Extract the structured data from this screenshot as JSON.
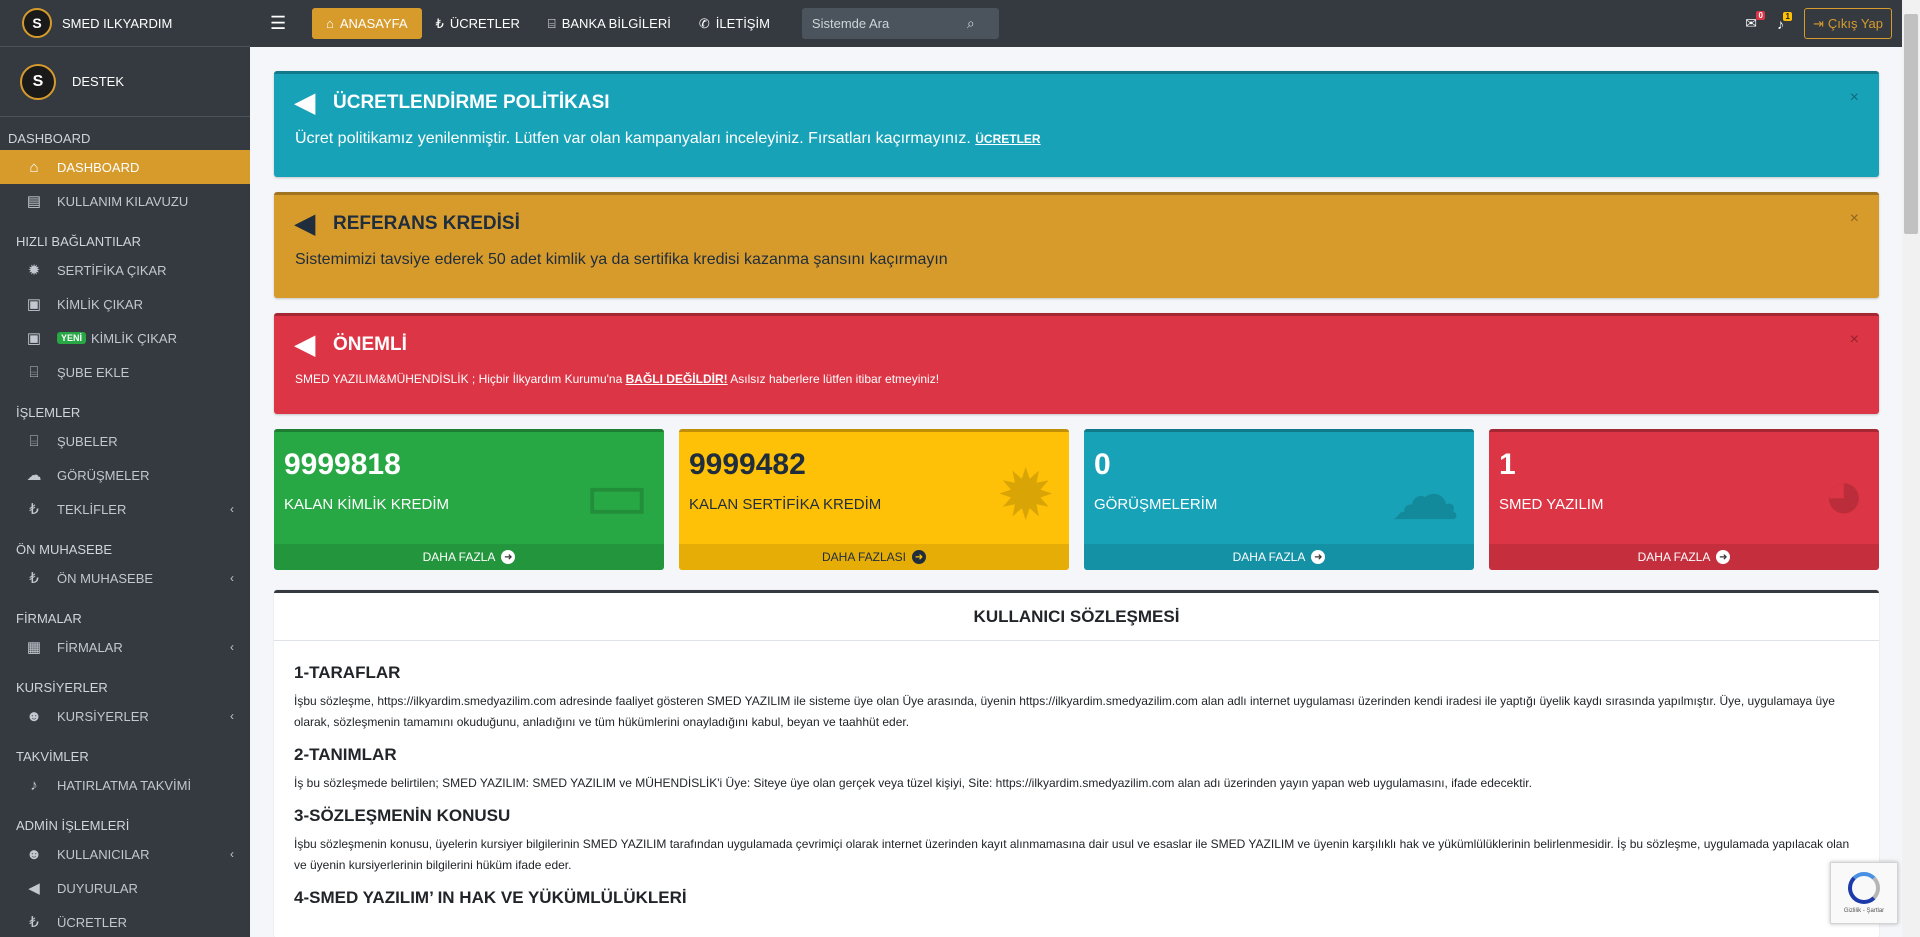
{
  "brand": {
    "logo": "S",
    "name": "SMED ILKYARDIM"
  },
  "user": {
    "logo": "S",
    "name": "DESTEK"
  },
  "sidebar": {
    "sections": [
      {
        "header": "DASHBOARD",
        "items": [
          {
            "label": "DASHBOARD",
            "icon": "home-icon",
            "glyph": "⌂",
            "active": true
          },
          {
            "label": "KULLANIM KILAVUZU",
            "icon": "book-icon",
            "glyph": "▤"
          }
        ]
      },
      {
        "header": "HIZLI BAĞLANTILAR",
        "items": [
          {
            "label": "SERTİFİKA ÇIKAR",
            "icon": "certificate-icon",
            "glyph": "✹"
          },
          {
            "label": "KİMLİK ÇIKAR",
            "icon": "id-card-icon",
            "glyph": "▣"
          },
          {
            "label": "KİMLİK ÇIKAR",
            "badge": "YENİ",
            "icon": "id-card-icon",
            "glyph": "▣"
          },
          {
            "label": "ŞUBE EKLE",
            "icon": "bank-icon",
            "glyph": "⌸"
          }
        ]
      },
      {
        "header": "İŞLEMLER",
        "items": [
          {
            "label": "ŞUBELER",
            "icon": "bank-icon",
            "glyph": "⌸"
          },
          {
            "label": "GÖRÜŞMELER",
            "icon": "comments-icon",
            "glyph": "☁"
          },
          {
            "label": "TEKLİFLER",
            "icon": "lira-icon",
            "glyph": "₺",
            "chevron": true
          }
        ]
      },
      {
        "header": "ÖN MUHASEBE",
        "items": [
          {
            "label": "ÖN MUHASEBE",
            "icon": "lira-icon",
            "glyph": "₺",
            "chevron": true
          }
        ]
      },
      {
        "header": "FİRMALAR",
        "items": [
          {
            "label": "FİRMALAR",
            "icon": "building-icon",
            "glyph": "▦",
            "chevron": true
          }
        ]
      },
      {
        "header": "KURSİYERLER",
        "items": [
          {
            "label": "KURSİYERLER",
            "icon": "users-icon",
            "glyph": "☻",
            "chevron": true
          }
        ]
      },
      {
        "header": "TAKVİMLER",
        "items": [
          {
            "label": "HATIRLATMA TAKVİMİ",
            "icon": "bell-icon",
            "glyph": "♪"
          }
        ]
      },
      {
        "header": "ADMİN İŞLEMLERİ",
        "items": [
          {
            "label": "KULLANICILAR",
            "icon": "users-icon",
            "glyph": "☻",
            "chevron": true
          },
          {
            "label": "DUYURULAR",
            "icon": "bullhorn-icon",
            "glyph": "◀"
          },
          {
            "label": "ÜCRETLER",
            "icon": "lira-icon",
            "glyph": "₺"
          }
        ]
      }
    ]
  },
  "topbar": {
    "menu_icon": "☰",
    "links": [
      {
        "label": "ANASAYFA",
        "icon": "home-icon",
        "glyph": "⌂",
        "active": true
      },
      {
        "label": "ÜCRETLER",
        "icon": "lira-icon",
        "glyph": "₺"
      },
      {
        "label": "BANKA BİLGİLERİ",
        "icon": "bank-icon",
        "glyph": "⌸"
      },
      {
        "label": "İLETİŞİM",
        "icon": "phone-icon",
        "glyph": "✆"
      }
    ],
    "search_placeholder": "Sistemde Ara",
    "messages_count": "0",
    "notifications_count": "1",
    "logout_label": "Çıkış Yap"
  },
  "alerts": {
    "pricing": {
      "title": "ÜCRETLENDİRME POLİTİKASI",
      "text": "Ücret politikamız yenilenmiştir. Lütfen var olan kampanyaları inceleyiniz. Fırsatları kaçırmayınız.",
      "link": "ÜCRETLER"
    },
    "referral": {
      "title": "REFERANS KREDİSİ",
      "text": "Sistemimizi tavsiye ederek 50 adet kimlik ya da sertifika kredisi kazanma şansını kaçırmayın"
    },
    "important": {
      "title": "ÖNEMLİ",
      "text_before": "SMED YAZILIM&MÜHENDİSLİK ; Hiçbir İlkyardım Kurumu'na",
      "link": "BAĞLI DEĞİLDİR!",
      "text_after": "Asılsız haberlere lütfen itibar etmeyiniz!"
    }
  },
  "stats": [
    {
      "value": "9999818",
      "label": "KALAN KİMLİK KREDİM",
      "more": "DAHA FAZLA",
      "color": "green",
      "icon": "id-card-icon",
      "glyph": "▭"
    },
    {
      "value": "9999482",
      "label": "KALAN SERTİFİKA KREDİM",
      "more": "DAHA FAZLASI",
      "color": "yellow",
      "icon": "certificate-icon",
      "glyph": "✹"
    },
    {
      "value": "0",
      "label": "GÖRÜŞMELERİM",
      "more": "DAHA FAZLA",
      "color": "cyan",
      "icon": "comments-dollar-icon",
      "glyph": "☁"
    },
    {
      "value": "1",
      "label": "SMED YAZILIM",
      "more": "DAHA FAZLA",
      "color": "red",
      "icon": "pie-chart-icon",
      "glyph": "◕"
    }
  ],
  "agreement": {
    "title": "KULLANICI SÖZLEŞMESİ",
    "sections": [
      {
        "title": "1-TARAFLAR",
        "text": "İşbu sözleşme, https://ilkyardim.smedyazilim.com adresinde faaliyet gösteren SMED YAZILIM ile sisteme üye olan Üye arasında, üyenin https://ilkyardim.smedyazilim.com alan adlı internet uygulaması üzerinden kendi iradesi ile yaptığı üyelik kaydı sırasında yapılmıştır. Üye, uygulamaya üye olarak, sözleşmenin tamamını okuduğunu, anladığını ve tüm hükümlerini onayladığını kabul, beyan ve taahhüt eder."
      },
      {
        "title": "2-TANIMLAR",
        "text": "İş bu sözleşmede belirtilen; SMED YAZILIM: SMED YAZILIM ve MÜHENDİSLİK'i Üye: Siteye üye olan gerçek veya tüzel kişiyi, Site: https://ilkyardim.smedyazilim.com alan adı üzerinden yayın yapan web uygulamasını, ifade edecektir."
      },
      {
        "title": "3-SÖZLEŞMENİN KONUSU",
        "text": "İşbu sözleşmenin konusu, üyelerin kursiyer bilgilerinin SMED YAZILIM tarafından uygulamada çevrimiçi olarak internet üzerinden kayıt alınmamasına dair usul ve esaslar ile SMED YAZILIM ve üyenin karşılıklı hak ve yükümlülüklerinin belirlenmesidir. İş bu sözleşme, uygulamada yapılacak olan ve üyenin kursiyerlerinin bilgilerini hüküm ifade eder."
      },
      {
        "title": "4-SMED YAZILIM’ IN HAK VE YÜKÜMLÜLÜKLERİ",
        "text": ""
      }
    ]
  },
  "recaptcha": {
    "text": "Gizlilik - Şartlar"
  }
}
